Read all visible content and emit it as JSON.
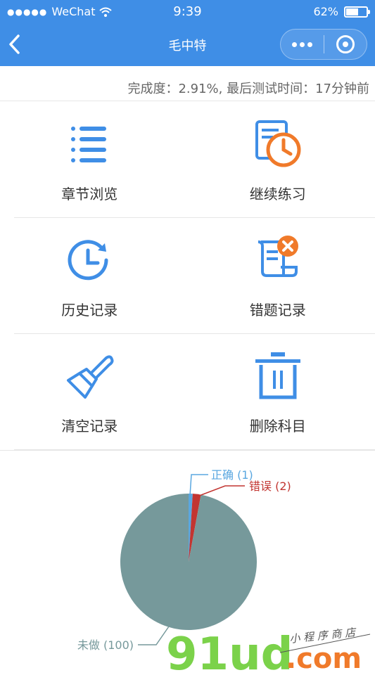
{
  "status_bar": {
    "carrier": "WeChat",
    "time": "9:39",
    "battery": "62%",
    "battery_level": 0.62
  },
  "nav": {
    "title": "毛中特",
    "more_icon": "more-dots-icon",
    "close_icon": "target-close-icon"
  },
  "progress": {
    "text": "完成度：2.91%, 最后测试时间：17分钟前"
  },
  "menu": [
    {
      "label": "章节浏览",
      "icon": "list-icon"
    },
    {
      "label": "继续练习",
      "icon": "document-clock-icon"
    },
    {
      "label": "历史记录",
      "icon": "history-clock-icon"
    },
    {
      "label": "错题记录",
      "icon": "scroll-error-icon"
    },
    {
      "label": "清空记录",
      "icon": "brush-icon"
    },
    {
      "label": "删除科目",
      "icon": "trash-icon"
    }
  ],
  "colors": {
    "primary": "#3f8ee6",
    "accent_orange": "#f07a2a",
    "pie_undone": "#76999b",
    "pie_correct": "#5aa7e0",
    "pie_wrong": "#c23531"
  },
  "chart_data": {
    "type": "pie",
    "slices": [
      {
        "label": "正确 (1)",
        "name": "正确",
        "value": 1
      },
      {
        "label": "错误 (2)",
        "name": "错误",
        "value": 2
      },
      {
        "label": "未做 (100)",
        "name": "未做",
        "value": 100
      }
    ]
  },
  "watermark": {
    "brand": "91ud",
    "domain": ".com",
    "tagline": "小程序商店"
  }
}
